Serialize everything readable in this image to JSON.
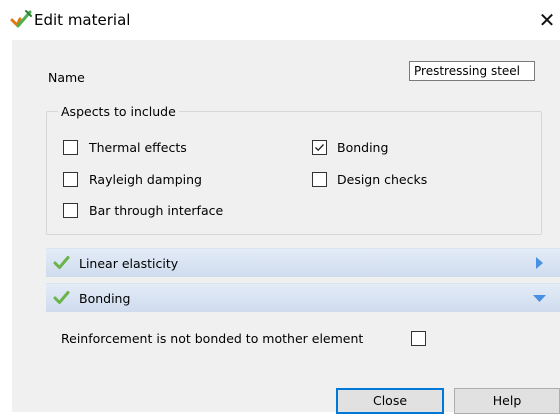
{
  "window": {
    "title": "Edit material",
    "icon": "material-edit-icon",
    "close_icon": "close-icon"
  },
  "name": {
    "label": "Name",
    "value": "Prestressing steel"
  },
  "aspects": {
    "title": "Aspects to include",
    "options": [
      {
        "label": "Thermal effects",
        "checked": false
      },
      {
        "label": "Rayleigh damping",
        "checked": false
      },
      {
        "label": "Bar through interface",
        "checked": false
      },
      {
        "label": "Bonding",
        "checked": true
      },
      {
        "label": "Design checks",
        "checked": false
      }
    ]
  },
  "sections": [
    {
      "label": "Linear elasticity",
      "status_icon": "check-icon",
      "expand_icon": "chevron-right-icon",
      "expanded": false
    },
    {
      "label": "Bonding",
      "status_icon": "check-icon",
      "expand_icon": "chevron-down-icon",
      "expanded": true
    }
  ],
  "bonding": {
    "option_label": "Reinforcement is not bonded to mother element",
    "checked": false
  },
  "buttons": {
    "close": "Close",
    "help": "Help"
  },
  "colors": {
    "accent": "#0078d7",
    "section_bg": "#d6e2f2",
    "arrow": "#4a90e2",
    "check": "#6bb34b"
  }
}
